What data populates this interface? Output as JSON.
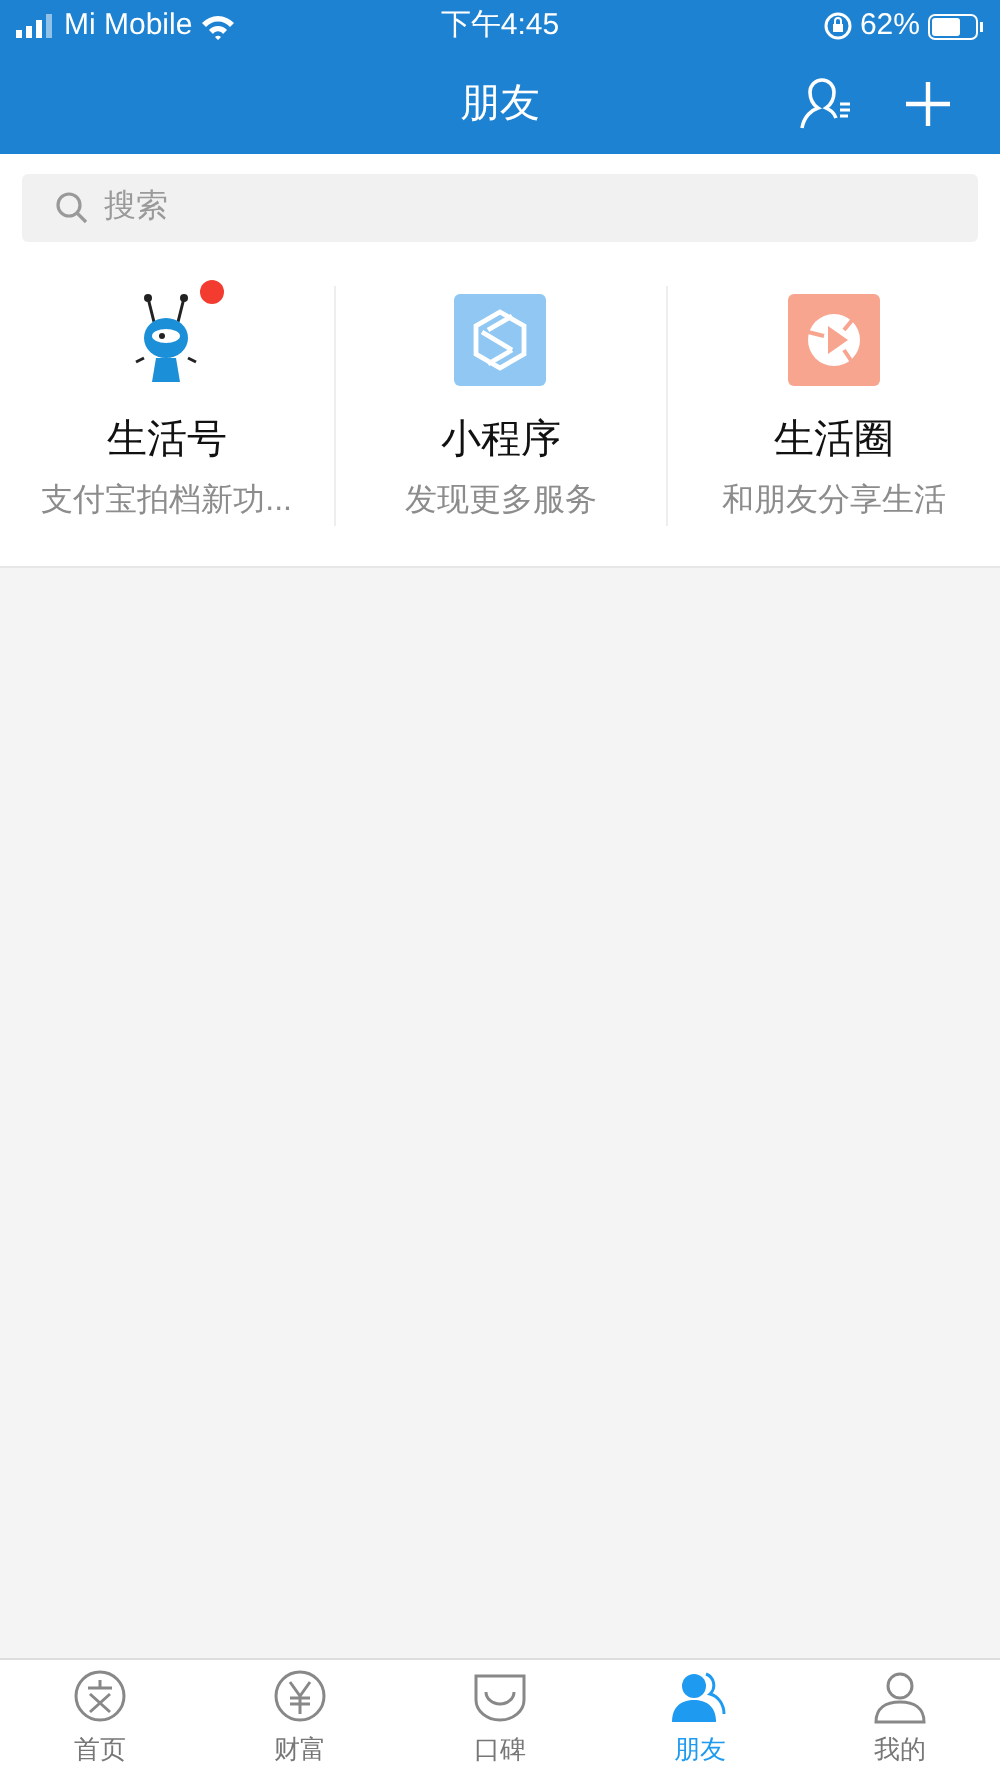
{
  "status_bar": {
    "carrier": "Mi Mobile",
    "time": "下午4:45",
    "battery": "62%"
  },
  "header": {
    "title": "朋友"
  },
  "search": {
    "placeholder": "搜索"
  },
  "entries": [
    {
      "kind": "ant",
      "title": "生活号",
      "subtitle": "支付宝拍档新功...",
      "badge": true
    },
    {
      "kind": "mini",
      "title": "小程序",
      "subtitle": "发现更多服务",
      "badge": false
    },
    {
      "kind": "circle",
      "title": "生活圈",
      "subtitle": "和朋友分享生活",
      "badge": false
    }
  ],
  "tabs": [
    {
      "kind": "home",
      "label": "首页",
      "selected": false
    },
    {
      "kind": "wealth",
      "label": "财富",
      "selected": false
    },
    {
      "kind": "koubei",
      "label": "口碑",
      "selected": false
    },
    {
      "kind": "friends",
      "label": "朋友",
      "selected": true
    },
    {
      "kind": "me",
      "label": "我的",
      "selected": false
    }
  ]
}
